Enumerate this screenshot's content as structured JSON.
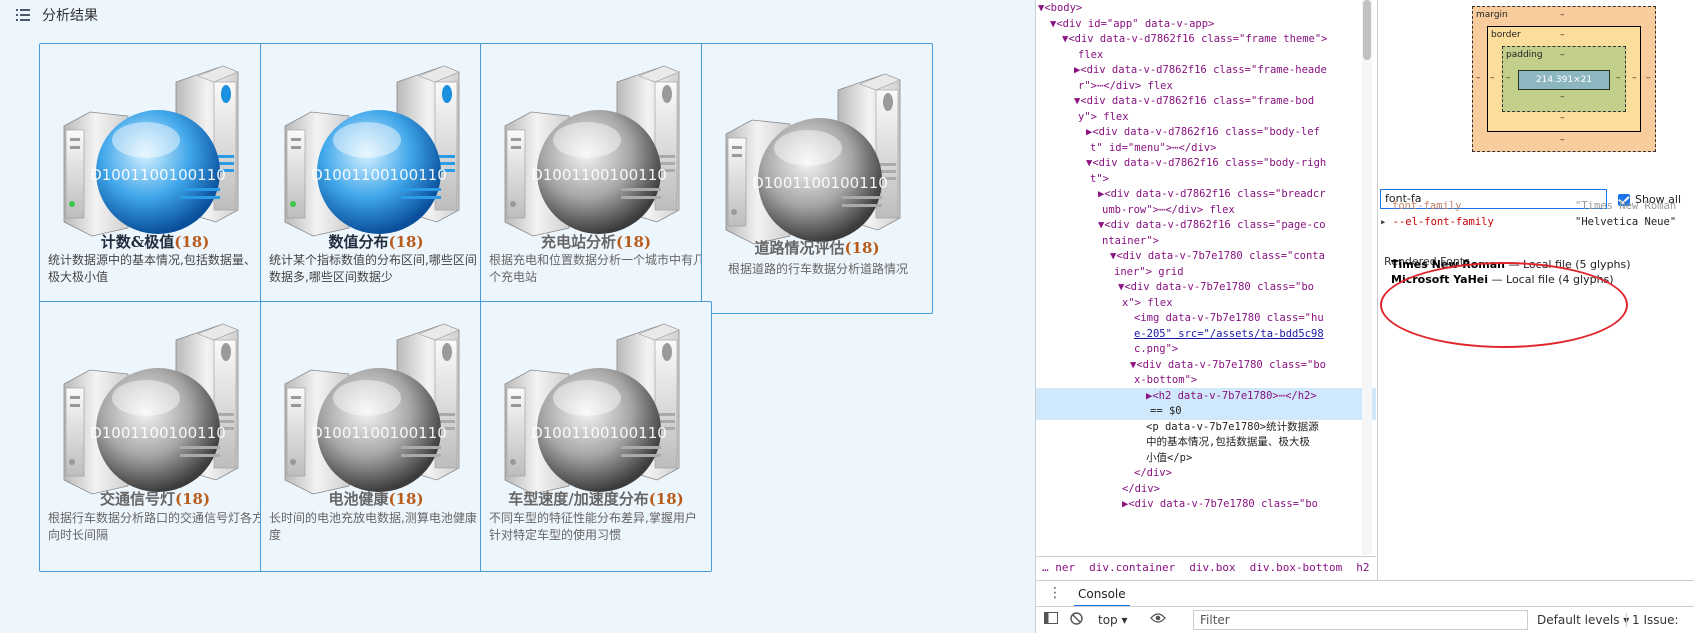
{
  "page": {
    "title": "分析结果",
    "cards": [
      {
        "title": "计数&极值",
        "count": "(18)",
        "desc": "统计数据源中的基本情况,包括数据量、极大极小值",
        "style": "blue"
      },
      {
        "title": "数值分布",
        "count": "(18)",
        "desc": "统计某个指标数值的分布区间,哪些区间数据多,哪些区间数据少",
        "style": "blue"
      },
      {
        "title": "充电站分析",
        "count": "(18)",
        "desc": "根据充电和位置数据分析一个城市中有几个充电站",
        "style": "gray"
      },
      {
        "title": "道路情况评估",
        "count": "(18)",
        "desc": "根据道路的行车数据分析道路情况",
        "style": "gray"
      },
      {
        "title": "交通信号灯",
        "count": "(18)",
        "desc": "根据行车数据分析路口的交通信号灯各方向时长间隔",
        "style": "gray"
      },
      {
        "title": "电池健康",
        "count": "(18)",
        "desc": "长时间的电池充放电数据,测算电池健康度",
        "style": "gray"
      },
      {
        "title": "车型速度/加速度分布",
        "count": "(18)",
        "desc": "不同车型的特征性能分布差异,掌握用户针对特定车型的使用习惯",
        "style": "gray"
      }
    ],
    "image_text": "D1001100100110"
  },
  "devtools": {
    "tree": [
      {
        "t": "▼<body>"
      },
      {
        "t": "▼<div id=\"app\" data-v-app>"
      },
      {
        "t": "▼<div data-v-d7862f16 class=\"frame theme\">"
      },
      {
        "t": "flex"
      },
      {
        "t": "▶<div data-v-d7862f16 class=\"frame-heade"
      },
      {
        "t": "r\">⋯</div> flex"
      },
      {
        "t": "▼<div data-v-d7862f16 class=\"frame-bod"
      },
      {
        "t": "y\"> flex"
      },
      {
        "t": "▶<div data-v-d7862f16 class=\"body-lef"
      },
      {
        "t": "t\" id=\"menu\">⋯</div>"
      },
      {
        "t": "▼<div data-v-d7862f16 class=\"body-righ"
      },
      {
        "t": "t\">"
      },
      {
        "t": "▶<div data-v-d7862f16 class=\"breadcr"
      },
      {
        "t": "umb-row\">⋯</div> flex"
      },
      {
        "t": "▼<div data-v-d7862f16 class=\"page-co"
      },
      {
        "t": "ntainer\">"
      },
      {
        "t": "▼<div data-v-7b7e1780 class=\"conta"
      },
      {
        "t": "iner\"> grid"
      },
      {
        "t": "▼<div data-v-7b7e1780 class=\"bo"
      },
      {
        "t": "x\"> flex"
      },
      {
        "t": "<img data-v-7b7e1780 class=\"hu"
      },
      {
        "t": "e-205\" src=\"/assets/ta-bdd5c98"
      },
      {
        "t": "c.png\">"
      },
      {
        "t": "▼<div data-v-7b7e1780 class=\"bo"
      },
      {
        "t": "x-bottom\">"
      },
      {
        "t": "▶<h2 data-v-7b7e1780>⋯</h2>"
      },
      {
        "t": "== $0"
      },
      {
        "t": "<p data-v-7b7e1780>统计数据源"
      },
      {
        "t": "中的基本情况,包括数据量、极大极"
      },
      {
        "t": "小值</p>"
      },
      {
        "t": "</div>"
      },
      {
        "t": "</div>"
      },
      {
        "t": "▶<div data-v-7b7e1780 class=\"bo"
      }
    ],
    "crumbs": [
      "… ner",
      "div.container",
      "div.box",
      "div.box-bottom",
      "h2",
      "…"
    ],
    "boxmodel": {
      "margin": "margin",
      "border": "border",
      "padding": "padding",
      "content": "214.391×21",
      "dash": "–"
    },
    "filter_value": "font-fa",
    "show_all": "Show all",
    "props": [
      {
        "name": "font-family",
        "value": "\"Times New Roman"
      },
      {
        "name": "--el-font-family",
        "value": "\"Helvetica Neue\""
      }
    ],
    "rendered_fonts_title": "Rendered Fonts",
    "rendered_fonts": [
      {
        "name": "Times New Roman",
        "info": " — Local file (5 glyphs)"
      },
      {
        "name": "Microsoft YaHei",
        "info": " — Local file (4 glyphs)"
      }
    ],
    "console_tab": "Console",
    "console_toolbar": {
      "context": "top",
      "filter_placeholder": "Filter",
      "levels": "Default levels",
      "issues": "1 Issue:"
    }
  }
}
